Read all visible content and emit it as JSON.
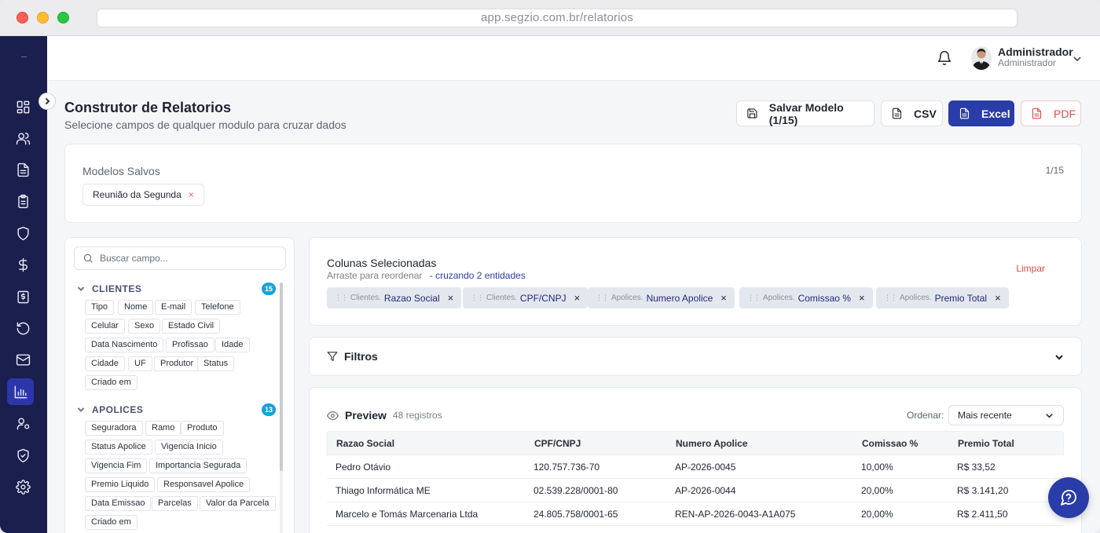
{
  "browser": {
    "url": "app.segzio.com.br/relatorios"
  },
  "user": {
    "name": "Administrador",
    "role": "Administrador"
  },
  "page": {
    "title": "Construtor de Relatorios",
    "subtitle": "Selecione campos de qualquer modulo para cruzar dados"
  },
  "actions": {
    "save": "Salvar Modelo (1/15)",
    "csv": "CSV",
    "excel": "Excel",
    "pdf": "PDF"
  },
  "models": {
    "title": "Modelos Salvos",
    "count": "1/15",
    "items": [
      {
        "label": "Reunião da Segunda",
        "remove": "×"
      }
    ]
  },
  "fields": {
    "search_placeholder": "Buscar campo...",
    "groups": [
      {
        "name": "CLIENTES",
        "count": "15",
        "items": [
          "Tipo",
          "Nome",
          "E-mail",
          "Telefone",
          "Celular",
          "Sexo",
          "Estado Civil",
          "Data Nascimento",
          "Profissao",
          "Idade",
          "Cidade",
          "UF",
          "Produtor",
          "Status",
          "Criado em"
        ]
      },
      {
        "name": "APOLICES",
        "count": "13",
        "items": [
          "Seguradora",
          "Ramo",
          "Produto",
          "Status Apolice",
          "Vigencia Inicio",
          "Vigencia Fim",
          "Importancia Segurada",
          "Premio Liquido",
          "Responsavel Apolice",
          "Data Emissao",
          "Parcelas",
          "Valor da Parcela",
          "Criado em"
        ]
      }
    ]
  },
  "columns": {
    "title": "Colunas Selecionadas",
    "hint": "Arraste para reordenar",
    "cross": "- cruzando 2 entidades",
    "clear": "Limpar",
    "chips": [
      {
        "entity": "Clientes.",
        "name": "Razao Social"
      },
      {
        "entity": "Clientes.",
        "name": "CPF/CNPJ"
      },
      {
        "entity": "Apolices.",
        "name": "Numero Apolice"
      },
      {
        "entity": "Apolices.",
        "name": "Comissao %"
      },
      {
        "entity": "Apolices.",
        "name": "Premio Total"
      }
    ]
  },
  "filters": {
    "label": "Filtros"
  },
  "preview": {
    "title": "Preview",
    "count": "48 registros",
    "order_label": "Ordenar:",
    "order_value": "Mais recente",
    "headers": [
      "Razao Social",
      "CPF/CNPJ",
      "Numero Apolice",
      "Comissao %",
      "Premio Total"
    ],
    "rows": [
      [
        "Pedro Otávio",
        "120.757.736-70",
        "AP-2026-0045",
        "10,00%",
        "R$ 33,52"
      ],
      [
        "Thiago Informática ME",
        "02.539.228/0001-80",
        "AP-2026-0044",
        "20,00%",
        "R$ 3.141,20"
      ],
      [
        "Marcelo e Tomás Marcenaria Ltda",
        "24.805.758/0001-65",
        "REN-AP-2026-0043-A1A075",
        "20,00%",
        "R$ 2.411,50"
      ]
    ]
  }
}
